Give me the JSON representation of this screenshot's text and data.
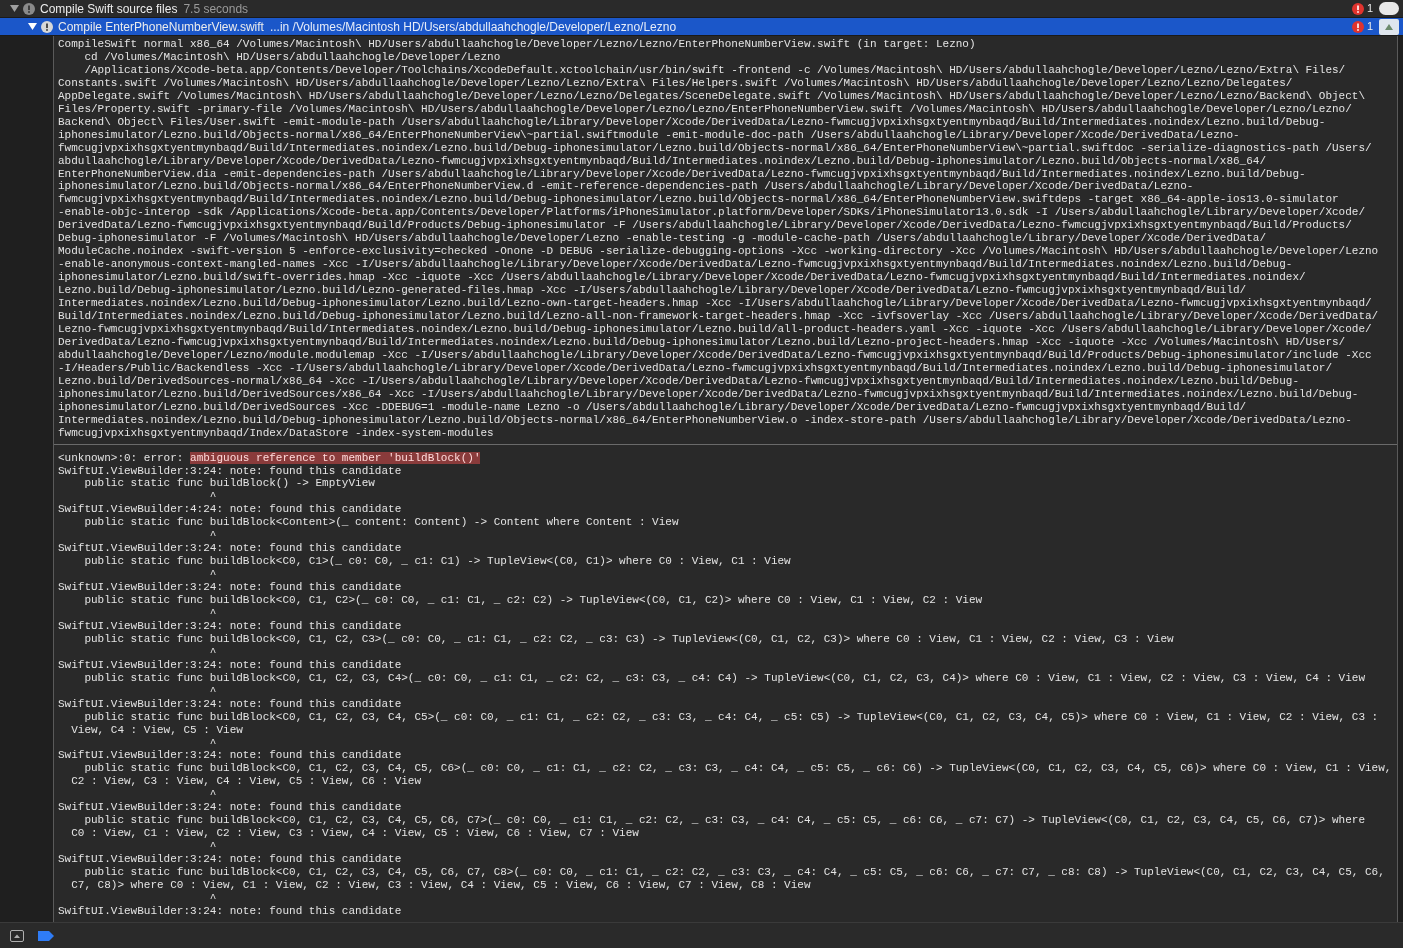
{
  "rows": [
    {
      "kind": "group",
      "expanded": true,
      "selected": false,
      "title": "Compile Swift source files",
      "detail": "7.5 seconds",
      "error_count": "1"
    },
    {
      "kind": "file",
      "expanded": true,
      "selected": true,
      "title": "Compile EnterPhoneNumberView.swift",
      "detail": "...in /Volumes/Macintosh HD/Users/abdullaahchogle/Developer/Lezno/Lezno",
      "error_count": "1"
    }
  ],
  "command_lines": [
    "CompileSwift normal x86_64 /Volumes/Macintosh\\ HD/Users/abdullaahchogle/Developer/Lezno/Lezno/EnterPhoneNumberView.swift (in target: Lezno)",
    "    cd /Volumes/Macintosh\\ HD/Users/abdullaahchogle/Developer/Lezno",
    "    /Applications/Xcode-beta.app/Contents/Developer/Toolchains/XcodeDefault.xctoolchain/usr/bin/swift -frontend -c /Volumes/Macintosh\\ HD/Users/abdullaahchogle/Developer/Lezno/Lezno/Extra\\ Files/",
    "Constants.swift /Volumes/Macintosh\\ HD/Users/abdullaahchogle/Developer/Lezno/Lezno/Extra\\ Files/Helpers.swift /Volumes/Macintosh\\ HD/Users/abdullaahchogle/Developer/Lezno/Lezno/Delegates/",
    "AppDelegate.swift /Volumes/Macintosh\\ HD/Users/abdullaahchogle/Developer/Lezno/Lezno/Delegates/SceneDelegate.swift /Volumes/Macintosh\\ HD/Users/abdullaahchogle/Developer/Lezno/Lezno/Backend\\ Object\\",
    "Files/Property.swift -primary-file /Volumes/Macintosh\\ HD/Users/abdullaahchogle/Developer/Lezno/Lezno/EnterPhoneNumberView.swift /Volumes/Macintosh\\ HD/Users/abdullaahchogle/Developer/Lezno/Lezno/",
    "Backend\\ Object\\ Files/User.swift -emit-module-path /Users/abdullaahchogle/Library/Developer/Xcode/DerivedData/Lezno-fwmcugjvpxixhsgxtyentmynbaqd/Build/Intermediates.noindex/Lezno.build/Debug-",
    "iphonesimulator/Lezno.build/Objects-normal/x86_64/EnterPhoneNumberView\\~partial.swiftmodule -emit-module-doc-path /Users/abdullaahchogle/Library/Developer/Xcode/DerivedData/Lezno-",
    "fwmcugjvpxixhsgxtyentmynbaqd/Build/Intermediates.noindex/Lezno.build/Debug-iphonesimulator/Lezno.build/Objects-normal/x86_64/EnterPhoneNumberView\\~partial.swiftdoc -serialize-diagnostics-path /Users/",
    "abdullaahchogle/Library/Developer/Xcode/DerivedData/Lezno-fwmcugjvpxixhsgxtyentmynbaqd/Build/Intermediates.noindex/Lezno.build/Debug-iphonesimulator/Lezno.build/Objects-normal/x86_64/",
    "EnterPhoneNumberView.dia -emit-dependencies-path /Users/abdullaahchogle/Library/Developer/Xcode/DerivedData/Lezno-fwmcugjvpxixhsgxtyentmynbaqd/Build/Intermediates.noindex/Lezno.build/Debug-",
    "iphonesimulator/Lezno.build/Objects-normal/x86_64/EnterPhoneNumberView.d -emit-reference-dependencies-path /Users/abdullaahchogle/Library/Developer/Xcode/DerivedData/Lezno-",
    "fwmcugjvpxixhsgxtyentmynbaqd/Build/Intermediates.noindex/Lezno.build/Debug-iphonesimulator/Lezno.build/Objects-normal/x86_64/EnterPhoneNumberView.swiftdeps -target x86_64-apple-ios13.0-simulator",
    "-enable-objc-interop -sdk /Applications/Xcode-beta.app/Contents/Developer/Platforms/iPhoneSimulator.platform/Developer/SDKs/iPhoneSimulator13.0.sdk -I /Users/abdullaahchogle/Library/Developer/Xcode/",
    "DerivedData/Lezno-fwmcugjvpxixhsgxtyentmynbaqd/Build/Products/Debug-iphonesimulator -F /Users/abdullaahchogle/Library/Developer/Xcode/DerivedData/Lezno-fwmcugjvpxixhsgxtyentmynbaqd/Build/Products/",
    "Debug-iphonesimulator -F /Volumes/Macintosh\\ HD/Users/abdullaahchogle/Developer/Lezno -enable-testing -g -module-cache-path /Users/abdullaahchogle/Library/Developer/Xcode/DerivedData/",
    "ModuleCache.noindex -swift-version 5 -enforce-exclusivity=checked -Onone -D DEBUG -serialize-debugging-options -Xcc -working-directory -Xcc /Volumes/Macintosh\\ HD/Users/abdullaahchogle/Developer/Lezno",
    "-enable-anonymous-context-mangled-names -Xcc -I/Users/abdullaahchogle/Library/Developer/Xcode/DerivedData/Lezno-fwmcugjvpxixhsgxtyentmynbaqd/Build/Intermediates.noindex/Lezno.build/Debug-",
    "iphonesimulator/Lezno.build/swift-overrides.hmap -Xcc -iquote -Xcc /Users/abdullaahchogle/Library/Developer/Xcode/DerivedData/Lezno-fwmcugjvpxixhsgxtyentmynbaqd/Build/Intermediates.noindex/",
    "Lezno.build/Debug-iphonesimulator/Lezno.build/Lezno-generated-files.hmap -Xcc -I/Users/abdullaahchogle/Library/Developer/Xcode/DerivedData/Lezno-fwmcugjvpxixhsgxtyentmynbaqd/Build/",
    "Intermediates.noindex/Lezno.build/Debug-iphonesimulator/Lezno.build/Lezno-own-target-headers.hmap -Xcc -I/Users/abdullaahchogle/Library/Developer/Xcode/DerivedData/Lezno-fwmcugjvpxixhsgxtyentmynbaqd/",
    "Build/Intermediates.noindex/Lezno.build/Debug-iphonesimulator/Lezno.build/Lezno-all-non-framework-target-headers.hmap -Xcc -ivfsoverlay -Xcc /Users/abdullaahchogle/Library/Developer/Xcode/DerivedData/",
    "Lezno-fwmcugjvpxixhsgxtyentmynbaqd/Build/Intermediates.noindex/Lezno.build/Debug-iphonesimulator/Lezno.build/all-product-headers.yaml -Xcc -iquote -Xcc /Users/abdullaahchogle/Library/Developer/Xcode/",
    "DerivedData/Lezno-fwmcugjvpxixhsgxtyentmynbaqd/Build/Intermediates.noindex/Lezno.build/Debug-iphonesimulator/Lezno.build/Lezno-project-headers.hmap -Xcc -iquote -Xcc /Volumes/Macintosh\\ HD/Users/",
    "abdullaahchogle/Developer/Lezno/module.modulemap -Xcc -I/Users/abdullaahchogle/Library/Developer/Xcode/DerivedData/Lezno-fwmcugjvpxixhsgxtyentmynbaqd/Build/Products/Debug-iphonesimulator/include -Xcc",
    "-I/Headers/Public/Backendless -Xcc -I/Users/abdullaahchogle/Library/Developer/Xcode/DerivedData/Lezno-fwmcugjvpxixhsgxtyentmynbaqd/Build/Intermediates.noindex/Lezno.build/Debug-iphonesimulator/",
    "Lezno.build/DerivedSources-normal/x86_64 -Xcc -I/Users/abdullaahchogle/Library/Developer/Xcode/DerivedData/Lezno-fwmcugjvpxixhsgxtyentmynbaqd/Build/Intermediates.noindex/Lezno.build/Debug-",
    "iphonesimulator/Lezno.build/DerivedSources/x86_64 -Xcc -I/Users/abdullaahchogle/Library/Developer/Xcode/DerivedData/Lezno-fwmcugjvpxixhsgxtyentmynbaqd/Build/Intermediates.noindex/Lezno.build/Debug-",
    "iphonesimulator/Lezno.build/DerivedSources -Xcc -DDEBUG=1 -module-name Lezno -o /Users/abdullaahchogle/Library/Developer/Xcode/DerivedData/Lezno-fwmcugjvpxixhsgxtyentmynbaqd/Build/",
    "Intermediates.noindex/Lezno.build/Debug-iphonesimulator/Lezno.build/Objects-normal/x86_64/EnterPhoneNumberView.o -index-store-path /Users/abdullaahchogle/Library/Developer/Xcode/DerivedData/Lezno-",
    "fwmcugjvpxixhsgxtyentmynbaqd/Index/DataStore -index-system-modules"
  ],
  "error": {
    "prefix": "<unknown>:0: error: ",
    "message": "ambiguous reference to member 'buildBlock()'"
  },
  "notes": [
    {
      "location": "SwiftUI.ViewBuilder:3:24: note: found this candidate",
      "code_lines": [
        "    public static func buildBlock() -> EmptyView"
      ],
      "caret": "                       ^"
    },
    {
      "location": "SwiftUI.ViewBuilder:4:24: note: found this candidate",
      "code_lines": [
        "    public static func buildBlock<Content>(_ content: Content) -> Content where Content : View"
      ],
      "caret": "                       ^"
    },
    {
      "location": "SwiftUI.ViewBuilder:3:24: note: found this candidate",
      "code_lines": [
        "    public static func buildBlock<C0, C1>(_ c0: C0, _ c1: C1) -> TupleView<(C0, C1)> where C0 : View, C1 : View"
      ],
      "caret": "                       ^"
    },
    {
      "location": "SwiftUI.ViewBuilder:3:24: note: found this candidate",
      "code_lines": [
        "    public static func buildBlock<C0, C1, C2>(_ c0: C0, _ c1: C1, _ c2: C2) -> TupleView<(C0, C1, C2)> where C0 : View, C1 : View, C2 : View"
      ],
      "caret": "                       ^"
    },
    {
      "location": "SwiftUI.ViewBuilder:3:24: note: found this candidate",
      "code_lines": [
        "    public static func buildBlock<C0, C1, C2, C3>(_ c0: C0, _ c1: C1, _ c2: C2, _ c3: C3) -> TupleView<(C0, C1, C2, C3)> where C0 : View, C1 : View, C2 : View, C3 : View"
      ],
      "caret": "                       ^"
    },
    {
      "location": "SwiftUI.ViewBuilder:3:24: note: found this candidate",
      "code_lines": [
        "    public static func buildBlock<C0, C1, C2, C3, C4>(_ c0: C0, _ c1: C1, _ c2: C2, _ c3: C3, _ c4: C4) -> TupleView<(C0, C1, C2, C3, C4)> where C0 : View, C1 : View, C2 : View, C3 : View, C4 : View"
      ],
      "caret": "                       ^"
    },
    {
      "location": "SwiftUI.ViewBuilder:3:24: note: found this candidate",
      "code_lines": [
        "    public static func buildBlock<C0, C1, C2, C3, C4, C5>(_ c0: C0, _ c1: C1, _ c2: C2, _ c3: C3, _ c4: C4, _ c5: C5) -> TupleView<(C0, C1, C2, C3, C4, C5)> where C0 : View, C1 : View, C2 : View, C3 :",
        "  View, C4 : View, C5 : View"
      ],
      "caret": "                       ^"
    },
    {
      "location": "SwiftUI.ViewBuilder:3:24: note: found this candidate",
      "code_lines": [
        "    public static func buildBlock<C0, C1, C2, C3, C4, C5, C6>(_ c0: C0, _ c1: C1, _ c2: C2, _ c3: C3, _ c4: C4, _ c5: C5, _ c6: C6) -> TupleView<(C0, C1, C2, C3, C4, C5, C6)> where C0 : View, C1 : View,",
        "  C2 : View, C3 : View, C4 : View, C5 : View, C6 : View"
      ],
      "caret": "                       ^"
    },
    {
      "location": "SwiftUI.ViewBuilder:3:24: note: found this candidate",
      "code_lines": [
        "    public static func buildBlock<C0, C1, C2, C3, C4, C5, C6, C7>(_ c0: C0, _ c1: C1, _ c2: C2, _ c3: C3, _ c4: C4, _ c5: C5, _ c6: C6, _ c7: C7) -> TupleView<(C0, C1, C2, C3, C4, C5, C6, C7)> where",
        "  C0 : View, C1 : View, C2 : View, C3 : View, C4 : View, C5 : View, C6 : View, C7 : View"
      ],
      "caret": "                       ^"
    },
    {
      "location": "SwiftUI.ViewBuilder:3:24: note: found this candidate",
      "code_lines": [
        "    public static func buildBlock<C0, C1, C2, C3, C4, C5, C6, C7, C8>(_ c0: C0, _ c1: C1, _ c2: C2, _ c3: C3, _ c4: C4, _ c5: C5, _ c6: C6, _ c7: C7, _ c8: C8) -> TupleView<(C0, C1, C2, C3, C4, C5, C6,",
        "  C7, C8)> where C0 : View, C1 : View, C2 : View, C3 : View, C4 : View, C5 : View, C6 : View, C7 : View, C8 : View"
      ],
      "caret": "                       ^"
    },
    {
      "location": "SwiftUI.ViewBuilder:3:24: note: found this candidate"
    }
  ]
}
